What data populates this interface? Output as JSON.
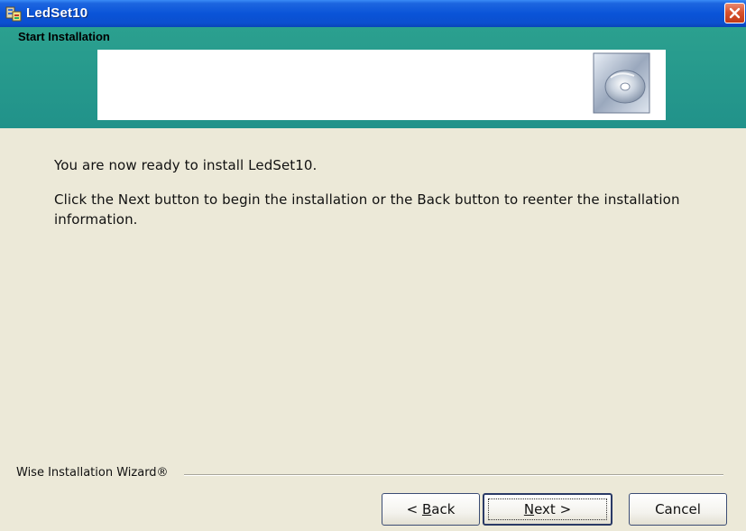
{
  "window": {
    "title": "LedSet10",
    "icon": "installer-icon",
    "close_icon": "close-icon",
    "title_bar_color": "#0a54d8"
  },
  "banner": {
    "title": "Start Installation",
    "icon": "cd-disc-icon",
    "background_color": "#21928a"
  },
  "content": {
    "line1": "You are now ready to install LedSet10.",
    "line2": "Click the Next button to begin the installation or the Back button to reenter the installation information."
  },
  "footer": {
    "brand": "Wise Installation Wizard®"
  },
  "buttons": {
    "back": {
      "prefix": "< ",
      "accel": "B",
      "rest": "ack"
    },
    "next": {
      "accel": "N",
      "rest": "ext >"
    },
    "cancel": "Cancel"
  }
}
